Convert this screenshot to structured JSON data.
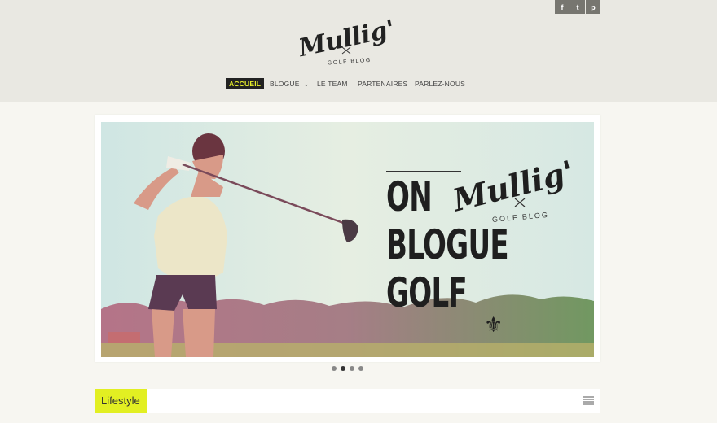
{
  "social": [
    "f",
    "t",
    "p"
  ],
  "social_icons": [
    "facebook-icon",
    "twitter-icon",
    "pinterest-icon"
  ],
  "logo": {
    "script": "Mullig'n",
    "tagline": "GOLF BLOG"
  },
  "nav": [
    {
      "label": "ACCUEIL",
      "active": true
    },
    {
      "label": "BLOGUE",
      "dropdown": "⌄"
    },
    {
      "label": "LE TEAM"
    },
    {
      "label": "PARTENAIRES"
    },
    {
      "label": "PARLEZ-NOUS"
    }
  ],
  "hero": {
    "lines": [
      "ON",
      "BLOGUE",
      "GOLF"
    ],
    "logo_script": "Mullig'n",
    "logo_tagline": "GOLF BLOG",
    "fleur": "⚜"
  },
  "slider": {
    "count": 4,
    "active_index": 1
  },
  "section": {
    "title": "Lifestyle"
  },
  "colors": {
    "accent": "#e2ef22",
    "header_bg": "#e9e8e2",
    "page_bg": "#f7f6f1"
  }
}
